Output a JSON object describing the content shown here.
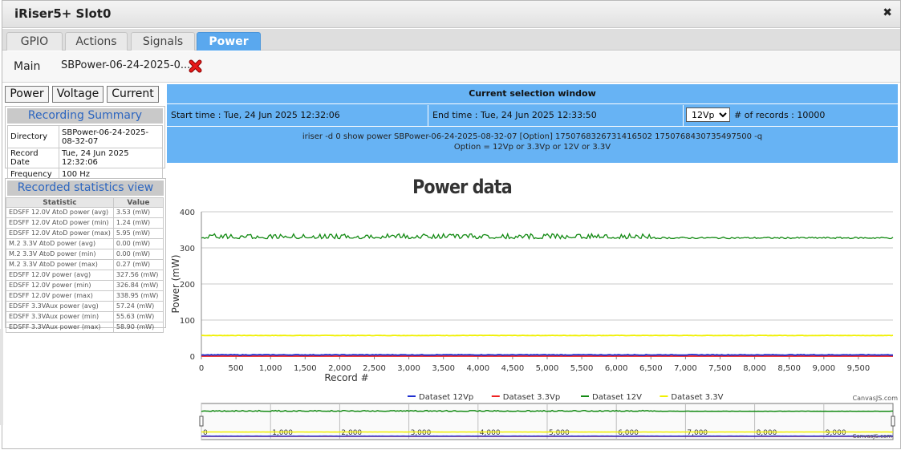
{
  "window": {
    "title": "iRiser5+ Slot0",
    "close_icon": "close-icon"
  },
  "tabs": [
    {
      "label": "GPIO",
      "active": false
    },
    {
      "label": "Actions",
      "active": false
    },
    {
      "label": "Signals",
      "active": false
    },
    {
      "label": "Power",
      "active": true
    }
  ],
  "main_row": {
    "label": "Main",
    "file": "SBPower-06-24-2025-0...",
    "delete_icon": "red-x-icon"
  },
  "view_buttons": [
    "Power",
    "Voltage",
    "Current"
  ],
  "recording_summary": {
    "title": "Recording Summary",
    "rows": [
      {
        "key": "Directory",
        "value": "SBPower-06-24-2025-08-32-07"
      },
      {
        "key": "Record Date",
        "value": "Tue, 24 Jun 2025 12:32:06"
      },
      {
        "key": "Frequency",
        "value": "100 Hz"
      }
    ]
  },
  "statistics": {
    "title": "Recorded statistics view",
    "headers": [
      "Statistic",
      "Value"
    ],
    "rows": [
      [
        "EDSFF 12.0V AtoD power (avg)",
        "3.53 (mW)"
      ],
      [
        "EDSFF 12.0V AtoD power (min)",
        "1.24 (mW)"
      ],
      [
        "EDSFF 12.0V AtoD power (max)",
        "5.95 (mW)"
      ],
      [
        "M.2 3.3V AtoD power (avg)",
        "0.00 (mW)"
      ],
      [
        "M.2 3.3V AtoD power (min)",
        "0.00 (mW)"
      ],
      [
        "M.2 3.3V AtoD power (max)",
        "0.27 (mW)"
      ],
      [
        "EDSFF 12.0V power (avg)",
        "327.56 (mW)"
      ],
      [
        "EDSFF 12.0V power (min)",
        "326.84 (mW)"
      ],
      [
        "EDSFF 12.0V power (max)",
        "338.95 (mW)"
      ],
      [
        "EDSFF 3.3VAux power (avg)",
        "57.24 (mW)"
      ],
      [
        "EDSFF 3.3VAux power (min)",
        "55.63 (mW)"
      ],
      [
        "EDSFF 3.3VAux power (max)",
        "58.90 (mW)"
      ]
    ]
  },
  "selection": {
    "title": "Current selection window",
    "start": "Start time : Tue, 24 Jun 2025 12:32:06",
    "end": "End time : Tue, 24 Jun 2025 12:33:50",
    "selected_dataset": "12Vp",
    "records_label": "# of records : 10000",
    "command": "iriser -d 0 show power SBPower-06-24-2025-08-32-07 [Option] 1750768326731416502 1750768430735497500 -q",
    "option_text": "Option = 12Vp or 3.3Vp or 12V or 3.3V"
  },
  "credit": "CanvasJS.com",
  "chart_data": {
    "type": "line",
    "title": "Power data",
    "xlabel": "Record #",
    "ylabel": "Power (mW)",
    "xlim": [
      0,
      10000
    ],
    "ylim": [
      0,
      400
    ],
    "x_ticks": [
      0,
      500,
      1000,
      1500,
      2000,
      2500,
      3000,
      3500,
      4000,
      4500,
      5000,
      5500,
      6000,
      6500,
      7000,
      7500,
      8000,
      8500,
      9000,
      9500
    ],
    "y_ticks": [
      0,
      100,
      200,
      300,
      400
    ],
    "grid": true,
    "legend_position": "bottom",
    "series": [
      {
        "name": "Dataset 12Vp",
        "color": "#1f2fd0",
        "avg": 3.53,
        "min": 1.24,
        "max": 5.95
      },
      {
        "name": "Dataset 3.3Vp",
        "color": "#ee2222",
        "avg": 0.0,
        "min": 0.0,
        "max": 0.27
      },
      {
        "name": "Dataset 12V",
        "color": "#138a13",
        "avg": 327.56,
        "min": 326.84,
        "max": 338.95
      },
      {
        "name": "Dataset 3.3V",
        "color": "#f0f000",
        "avg": 57.24,
        "min": 55.63,
        "max": 58.9
      }
    ],
    "navigator": {
      "x_ticks": [
        0,
        1000,
        2000,
        3000,
        4000,
        5000,
        6000,
        7000,
        8000,
        9000
      ]
    }
  }
}
